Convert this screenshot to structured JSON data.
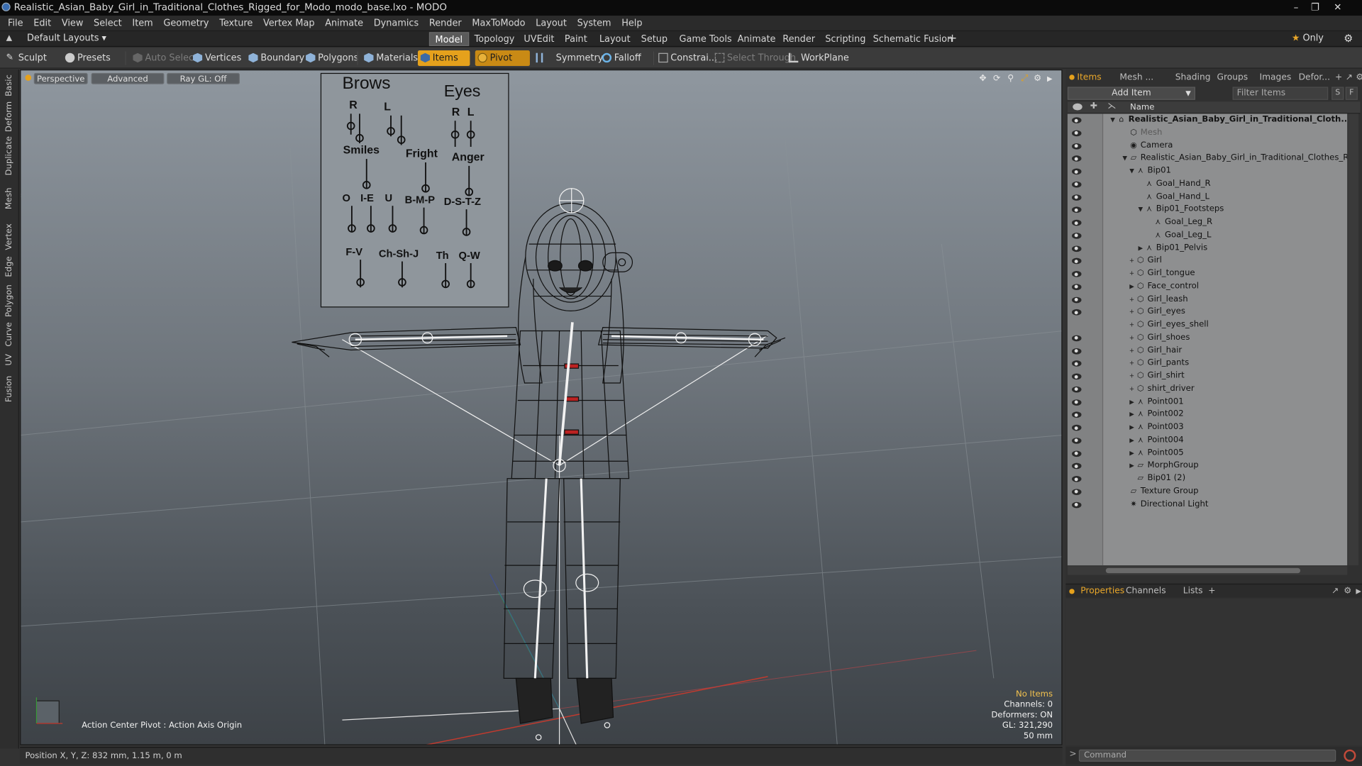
{
  "window": {
    "title": "Realistic_Asian_Baby_Girl_in_Traditional_Clothes_Rigged_for_Modo_modo_base.lxo - MODO"
  },
  "menu": [
    "File",
    "Edit",
    "View",
    "Select",
    "Item",
    "Geometry",
    "Texture",
    "Vertex Map",
    "Animate",
    "Dynamics",
    "Render",
    "MaxToModo",
    "Layout",
    "System",
    "Help"
  ],
  "layouts": {
    "selector": "Default Layouts",
    "tabs": [
      "Model",
      "Topology",
      "UVEdit",
      "Paint",
      "Layout",
      "Setup",
      "Game Tools",
      "Animate",
      "Render",
      "Scripting",
      "Schematic Fusion"
    ],
    "active": "Model",
    "add": "+",
    "only": "Only"
  },
  "toolbar": {
    "sculpt": "Sculpt",
    "presets": "Presets",
    "auto_select": "Auto Select",
    "vertices": "Vertices",
    "boundary": "Boundary",
    "polygons": "Polygons",
    "materials": "Materials",
    "items": "Items",
    "pivot": "Pivot",
    "symmetry": "Symmetry",
    "falloff": "Falloff",
    "constraints": "Constrai...",
    "select_through": "Select Through",
    "workplane": "WorkPlane"
  },
  "left_tabs": [
    "Basic",
    "Deform",
    "Duplicate",
    "Mesh Edit",
    "Vertex",
    "Edge",
    "Polygon",
    "Curve",
    "UV",
    "Fusion"
  ],
  "viewport": {
    "view": "Perspective",
    "shading": "Advanced",
    "raygl": "Ray GL: Off",
    "action_center": "Action Center Pivot : Action Axis Origin",
    "hud": {
      "selection": "No Items",
      "channels": "Channels: 0",
      "deformers": "Deformers: ON",
      "gl": "GL: 321,290",
      "lens": "50 mm"
    },
    "morph_chart": {
      "brows": "Brows",
      "eyes": "Eyes",
      "r1": "R",
      "l1": "L",
      "r2": "R",
      "l2": "L",
      "smiles": "Smiles",
      "fright": "Fright",
      "anger": "Anger",
      "o": "O",
      "ie": "I-E",
      "u": "U",
      "bmp": "B-M-P",
      "dstz": "D-S-T-Z",
      "fv": "F-V",
      "chshj": "Ch-Sh-J",
      "th": "Th",
      "qw": "Q-W"
    }
  },
  "status": {
    "position": "Position X, Y, Z:  832 mm, 1.15 m, 0 m"
  },
  "panel": {
    "tabs": [
      "Items",
      "Mesh ...",
      "Shading",
      "Groups",
      "Images",
      "Defor..."
    ],
    "active_tab": "Items",
    "add_item": "Add Item",
    "filter": "Filter Items",
    "s_btn": "S",
    "f_btn": "F",
    "col_name": "Name",
    "tree": [
      {
        "label": "Realistic_Asian_Baby_Girl_in_Traditional_Cloth...",
        "icon": "scene-icon",
        "eye": true,
        "bold": true
      },
      {
        "label": "Mesh",
        "icon": "mesh-icon",
        "eye": true,
        "dim": true
      },
      {
        "label": "Camera",
        "icon": "camera-icon",
        "eye": true
      },
      {
        "label": "Realistic_Asian_Baby_Girl_in_Traditional_Clothes_Rig ...",
        "icon": "group-icon",
        "eye": true
      },
      {
        "label": "Bip01",
        "icon": "locator-icon",
        "eye": true
      },
      {
        "label": "Goal_Hand_R",
        "icon": "locator-icon",
        "eye": true
      },
      {
        "label": "Goal_Hand_L",
        "icon": "locator-icon",
        "eye": true
      },
      {
        "label": "Bip01_Footsteps",
        "icon": "locator-icon",
        "eye": true
      },
      {
        "label": "Goal_Leg_R",
        "icon": "locator-icon",
        "eye": true
      },
      {
        "label": "Goal_Leg_L",
        "icon": "locator-icon",
        "eye": true
      },
      {
        "label": "Bip01_Pelvis",
        "icon": "locator-icon",
        "eye": true
      },
      {
        "label": "Girl",
        "icon": "mesh-icon",
        "eye": true
      },
      {
        "label": "Girl_tongue",
        "icon": "mesh-icon",
        "eye": true
      },
      {
        "label": "Face_control",
        "icon": "mesh-icon",
        "eye": true
      },
      {
        "label": "Girl_leash",
        "icon": "mesh-icon",
        "eye": true
      },
      {
        "label": "Girl_eyes",
        "icon": "mesh-icon",
        "eye": true
      },
      {
        "label": "Girl_eyes_shell",
        "icon": "mesh-icon",
        "eye": false
      },
      {
        "label": "Girl_shoes",
        "icon": "mesh-icon",
        "eye": true
      },
      {
        "label": "Girl_hair",
        "icon": "mesh-icon",
        "eye": true
      },
      {
        "label": "Girl_pants",
        "icon": "mesh-icon",
        "eye": true
      },
      {
        "label": "Girl_shirt",
        "icon": "mesh-icon",
        "eye": true
      },
      {
        "label": "shirt_driver",
        "icon": "mesh-icon",
        "eye": true
      },
      {
        "label": "Point001",
        "icon": "locator-icon",
        "eye": true
      },
      {
        "label": "Point002",
        "icon": "locator-icon",
        "eye": true
      },
      {
        "label": "Point003",
        "icon": "locator-icon",
        "eye": true
      },
      {
        "label": "Point004",
        "icon": "locator-icon",
        "eye": true
      },
      {
        "label": "Point005",
        "icon": "locator-icon",
        "eye": true
      },
      {
        "label": "MorphGroup",
        "icon": "group-icon",
        "eye": true
      },
      {
        "label": "Bip01 (2)",
        "icon": "group-icon",
        "eye": true
      },
      {
        "label": "Texture Group",
        "icon": "group-icon",
        "eye": true
      },
      {
        "label": "Directional Light",
        "icon": "light-icon",
        "eye": true
      }
    ],
    "bottom_tabs": [
      "Properties",
      "Channels",
      "Lists"
    ],
    "bottom_active": "Properties",
    "command_placeholder": "Command"
  },
  "colors": {
    "accent": "#e5a11c",
    "hud_highlight": "#f2c14e"
  }
}
